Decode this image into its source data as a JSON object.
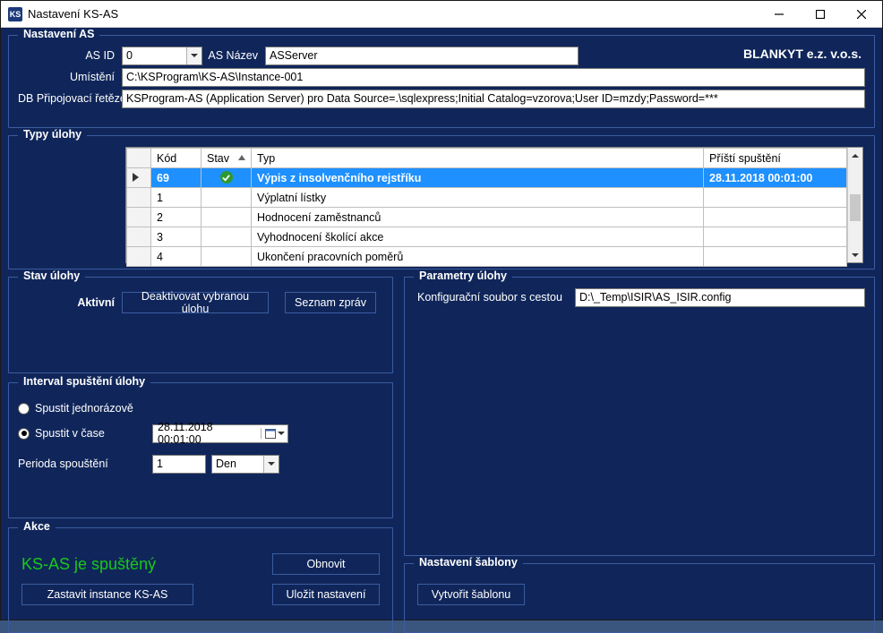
{
  "window": {
    "title": "Nastavení KS-AS"
  },
  "as": {
    "group_title": "Nastavení AS",
    "id_label": "AS ID",
    "id_value": "0",
    "name_label": "AS Název",
    "name_value": "ASServer",
    "company": "BLANKYT e.z. v.o.s.",
    "location_label": "Umístění",
    "location_value": "C:\\KSProgram\\KS-AS\\Instance-001",
    "db_label": "DB Připojovací řetězec",
    "db_value": "KSProgram-AS (Application Server) pro Data Source=.\\sqlexpress;Initial Catalog=vzorova;User ID=mzdy;Password=***"
  },
  "types": {
    "group_title": "Typy úlohy",
    "col_kod": "Kód",
    "col_stav": "Stav",
    "col_typ": "Typ",
    "col_next": "Příští spuštění",
    "rows": [
      {
        "kod": "69",
        "typ": "Výpis z insolvenčního rejstříku",
        "next": "28.11.2018  00:01:00",
        "sel": true,
        "ok": true
      },
      {
        "kod": "1",
        "typ": "Výplatní lístky",
        "next": ""
      },
      {
        "kod": "2",
        "typ": "Hodnocení zaměstnanců",
        "next": ""
      },
      {
        "kod": "3",
        "typ": "Vyhodnocení školící akce",
        "next": ""
      },
      {
        "kod": "4",
        "typ": "Ukončení pracovních poměrů",
        "next": ""
      }
    ]
  },
  "status": {
    "group_title": "Stav úlohy",
    "active_label": "Aktivní",
    "deactivate_btn": "Deaktivovat vybranou úlohu",
    "messages_btn": "Seznam zpráv"
  },
  "interval": {
    "group_title": "Interval spuštění úlohy",
    "once_label": "Spustit jednorázově",
    "at_time_label": "Spustit v čase",
    "datetime_value": "28.11.2018 00:01:00",
    "period_label": "Perioda spouštění",
    "period_value": "1",
    "period_unit": "Den"
  },
  "actions": {
    "group_title": "Akce",
    "running_text": "KS-AS je spuštěný",
    "refresh_btn": "Obnovit",
    "stop_btn": "Zastavit instance KS-AS",
    "save_btn": "Uložit nastavení"
  },
  "params": {
    "group_title": "Parametry úlohy",
    "config_label": "Konfigurační soubor s cestou",
    "config_value": "D:\\_Temp\\ISIR\\AS_ISIR.config"
  },
  "template": {
    "group_title": "Nastavení šablony",
    "create_btn": "Vytvořit šablonu"
  }
}
